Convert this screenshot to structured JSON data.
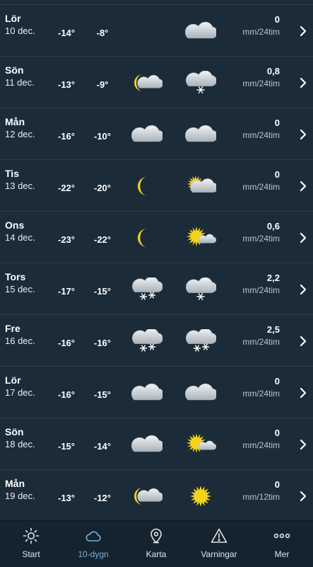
{
  "forecast": [
    {
      "day": "Lör",
      "date": "10 dec.",
      "tmin": "-14°",
      "tmax": "-8°",
      "icon1": "",
      "icon2": "cloud-icon",
      "precip": "0",
      "unit": "mm/24tim"
    },
    {
      "day": "Sön",
      "date": "11 dec.",
      "tmin": "-13°",
      "tmax": "-9°",
      "icon1": "moon-cloud-icon",
      "icon2": "cloud-snow-icon",
      "precip": "0,8",
      "unit": "mm/24tim"
    },
    {
      "day": "Mån",
      "date": "12 dec.",
      "tmin": "-16°",
      "tmax": "-10°",
      "icon1": "cloud-icon",
      "icon2": "cloud-icon",
      "precip": "0",
      "unit": "mm/24tim"
    },
    {
      "day": "Tis",
      "date": "13 dec.",
      "tmin": "-22°",
      "tmax": "-20°",
      "icon1": "moon-icon",
      "icon2": "sun-cloud-icon",
      "precip": "0",
      "unit": "mm/24tim"
    },
    {
      "day": "Ons",
      "date": "14 dec.",
      "tmin": "-23°",
      "tmax": "-22°",
      "icon1": "moon-icon",
      "icon2": "sun-small-cloud-icon",
      "precip": "0,6",
      "unit": "mm/24tim"
    },
    {
      "day": "Tors",
      "date": "15 dec.",
      "tmin": "-17°",
      "tmax": "-15°",
      "icon1": "cloud-heavy-snow-icon",
      "icon2": "cloud-snow-icon",
      "precip": "2,2",
      "unit": "mm/24tim"
    },
    {
      "day": "Fre",
      "date": "16 dec.",
      "tmin": "-16°",
      "tmax": "-16°",
      "icon1": "cloud-heavy-snow-icon",
      "icon2": "cloud-heavy-snow-icon",
      "precip": "2,5",
      "unit": "mm/24tim"
    },
    {
      "day": "Lör",
      "date": "17 dec.",
      "tmin": "-16°",
      "tmax": "-15°",
      "icon1": "cloud-icon",
      "icon2": "cloud-icon",
      "precip": "0",
      "unit": "mm/24tim"
    },
    {
      "day": "Sön",
      "date": "18 dec.",
      "tmin": "-15°",
      "tmax": "-14°",
      "icon1": "cloud-icon",
      "icon2": "sun-small-cloud-icon",
      "precip": "0",
      "unit": "mm/24tim"
    },
    {
      "day": "Mån",
      "date": "19 dec.",
      "tmin": "-13°",
      "tmax": "-12°",
      "icon1": "moon-cloud-icon",
      "icon2": "sun-icon",
      "precip": "0",
      "unit": "mm/12tim"
    }
  ],
  "nav": {
    "tabs": [
      {
        "label": "Start",
        "icon": "sun-outline-icon",
        "active": false
      },
      {
        "label": "10-dygn",
        "icon": "cloud-outline-icon",
        "active": true
      },
      {
        "label": "Karta",
        "icon": "map-pin-icon",
        "active": false
      },
      {
        "label": "Varningar",
        "icon": "warning-icon",
        "active": false
      },
      {
        "label": "Mer",
        "icon": "more-icon",
        "active": false
      }
    ]
  },
  "colors": {
    "background": "#1b2b38",
    "divider": "#2c3d4b",
    "accent": "#6fb3e0",
    "sun": "#f6d21a",
    "nav_background": "#15232e"
  }
}
